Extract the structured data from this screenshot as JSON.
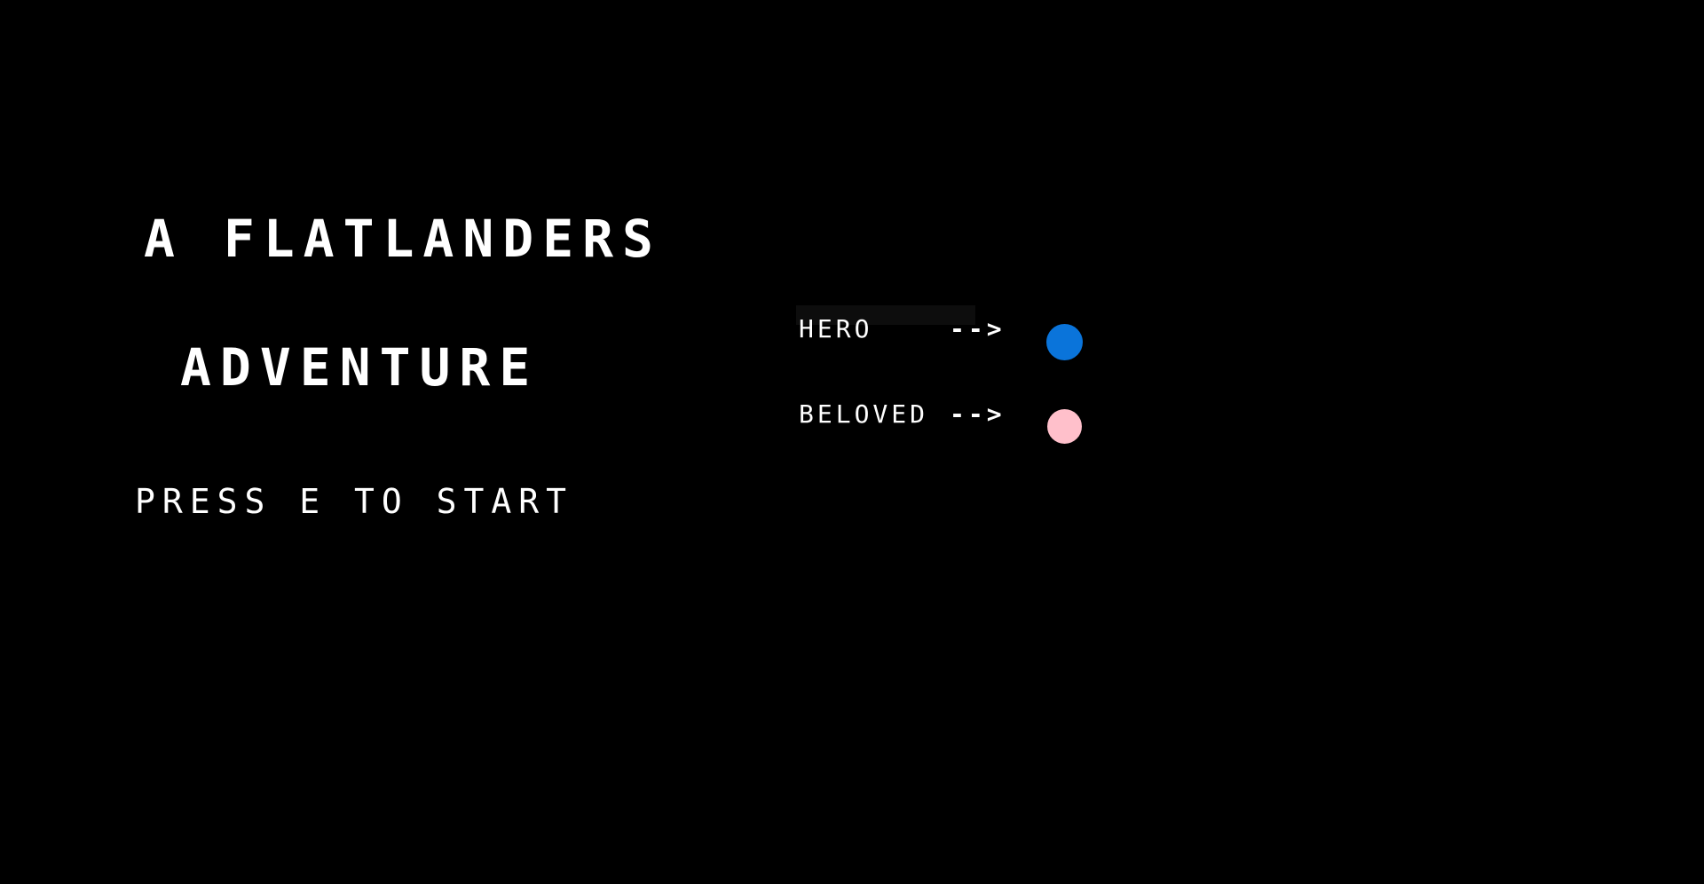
{
  "title": {
    "line1": "A FLATLANDERS",
    "line2": "ADVENTURE"
  },
  "prompt": "PRESS E TO START",
  "legend": {
    "hero": {
      "label": "HERO",
      "arrow": "-->",
      "color": "#0a74da"
    },
    "beloved": {
      "label": "BELOVED",
      "arrow": "-->",
      "color": "#ffc0cb"
    }
  },
  "colors": {
    "background": "#000000",
    "text": "#ffffff"
  }
}
